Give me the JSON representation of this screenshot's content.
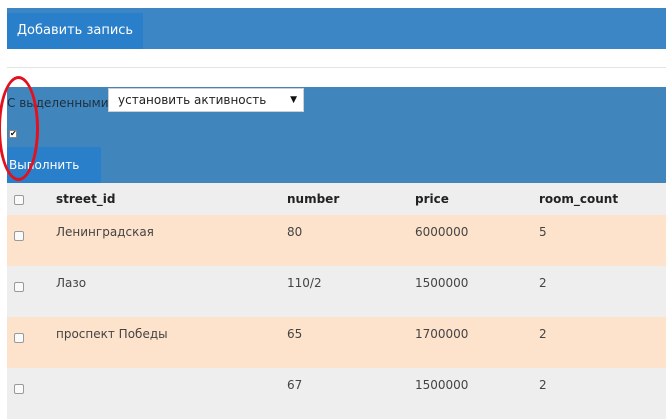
{
  "toolbar": {
    "add_label": "Добавить запись"
  },
  "bulk": {
    "label": "С выделенными",
    "action_selected": "установить активность",
    "run_label": "Выполнить"
  },
  "table": {
    "headers": [
      "street_id",
      "number",
      "price",
      "room_count"
    ],
    "rows": [
      {
        "street_id": "Ленинградская",
        "number": "80",
        "price": "6000000",
        "room_count": "5"
      },
      {
        "street_id": "Лазо",
        "number": "110/2",
        "price": "1500000",
        "room_count": "2"
      },
      {
        "street_id": "проспект Победы",
        "number": "65",
        "price": "1700000",
        "room_count": "2"
      },
      {
        "street_id": "",
        "number": "67",
        "price": "1500000",
        "room_count": "2"
      }
    ]
  },
  "colors": {
    "accent": "#2a7fca",
    "panel": "#4086bd",
    "highlight_row": "#fde3cc",
    "annotation": "#e3101d"
  },
  "icons": {
    "dropdown": "triangle-down-icon",
    "checked": "checkmark-icon"
  }
}
